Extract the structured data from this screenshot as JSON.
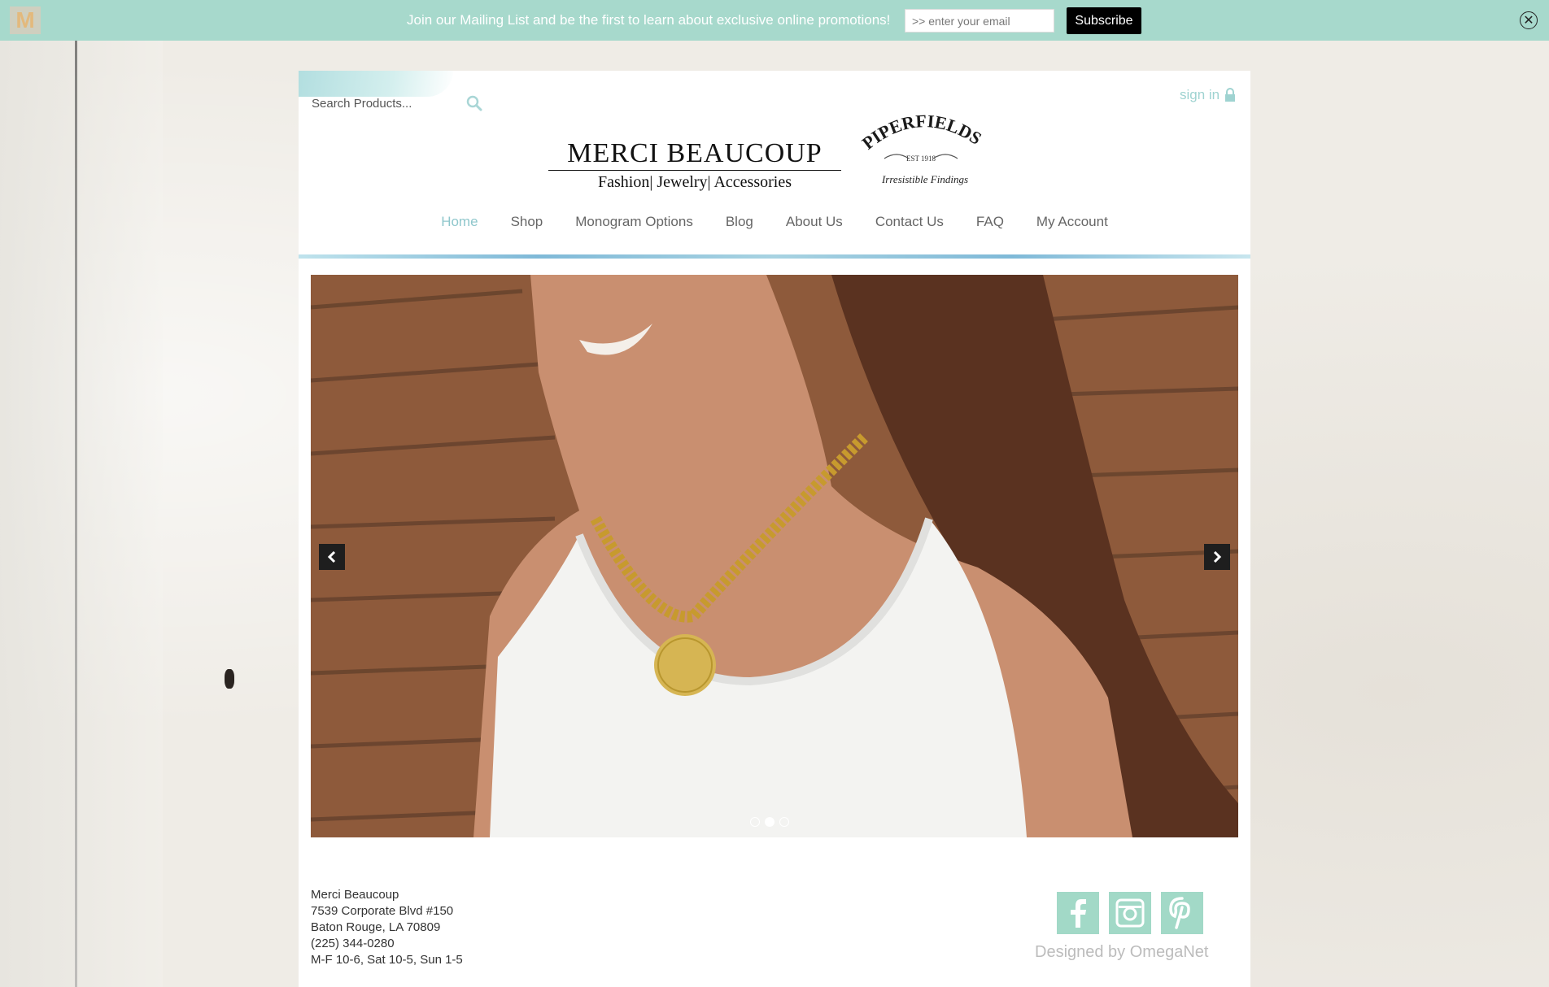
{
  "mailing_bar": {
    "logo_letter": "M",
    "text": "Join our Mailing List and be the first to learn about exclusive online promotions!",
    "email_placeholder": ">> enter your email",
    "subscribe_label": "Subscribe",
    "close_symbol": "✕"
  },
  "header": {
    "search_placeholder": "Search Products...",
    "sign_in_label": "sign in",
    "logo_main_title": "MERCI BEAUCOUP",
    "logo_main_subtitle": "Fashion| Jewelry| Accessories",
    "logo_secondary_title": "PIPERFIELDS",
    "logo_secondary_est": "EST 1918",
    "logo_secondary_tagline": "Irresistible Findings"
  },
  "nav": {
    "items": [
      {
        "label": "Home",
        "active": true
      },
      {
        "label": "Shop",
        "active": false
      },
      {
        "label": "Monogram Options",
        "active": false
      },
      {
        "label": "Blog",
        "active": false
      },
      {
        "label": "About Us",
        "active": false
      },
      {
        "label": "Contact Us",
        "active": false
      },
      {
        "label": "FAQ",
        "active": false
      },
      {
        "label": "My Account",
        "active": false
      }
    ]
  },
  "slider": {
    "prev_icon": "chevron-left-icon",
    "next_icon": "chevron-right-icon",
    "dot_count": 3,
    "active_dot": 2
  },
  "footer": {
    "address_lines": [
      "Merci Beaucoup",
      "7539 Corporate Blvd #150",
      "Baton Rouge, LA 70809",
      "(225) 344-0280",
      "M-F 10-6, Sat 10-5, Sun 1-5"
    ],
    "designed_by": "Designed by OmegaNet",
    "social_icons": [
      "facebook-icon",
      "instagram-icon",
      "pinterest-icon"
    ]
  },
  "colors": {
    "mail_bar": "#a7d9cc",
    "nav_active": "#8fc7cc",
    "social_tile": "#a2d9c7"
  }
}
